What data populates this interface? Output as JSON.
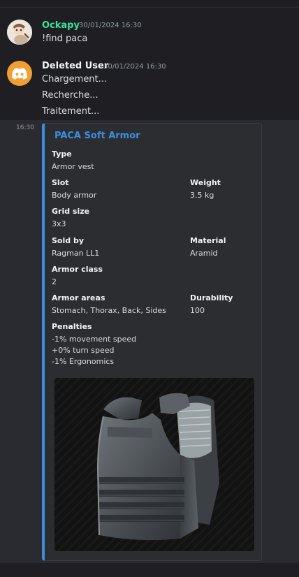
{
  "messages": [
    {
      "username": "Ockapy",
      "timestamp": "30/01/2024 16:30",
      "text": "!find paca",
      "name_color": "#3ee39b"
    },
    {
      "username": "Deleted User",
      "timestamp": "30/01/2024 16:30",
      "lines": [
        "Chargement...",
        "Recherche...",
        "Traitement..."
      ],
      "name_color": "#f2f3f5"
    }
  ],
  "side_time": "16:30",
  "embed": {
    "title": "PACA Soft Armor",
    "accent": "#3e8edc",
    "fields": {
      "type": {
        "name": "Type",
        "value": "Armor vest"
      },
      "slot": {
        "name": "Slot",
        "value": "Body armor"
      },
      "weight": {
        "name": "Weight",
        "value": "3.5 kg"
      },
      "grid": {
        "name": "Grid size",
        "value": "3x3"
      },
      "sold_by": {
        "name": "Sold by",
        "value": "Ragman LL1"
      },
      "material": {
        "name": "Material",
        "value": "Aramid"
      },
      "armor_class": {
        "name": "Armor class",
        "value": "2"
      },
      "armor_areas": {
        "name": "Armor areas",
        "value": "Stomach, Thorax, Back, Sides"
      },
      "durability": {
        "name": "Durability",
        "value": "100"
      },
      "penalties": {
        "name": "Penalties",
        "values": [
          "-1% movement speed",
          "+0% turn speed",
          "-1% Ergonomics"
        ]
      }
    }
  }
}
